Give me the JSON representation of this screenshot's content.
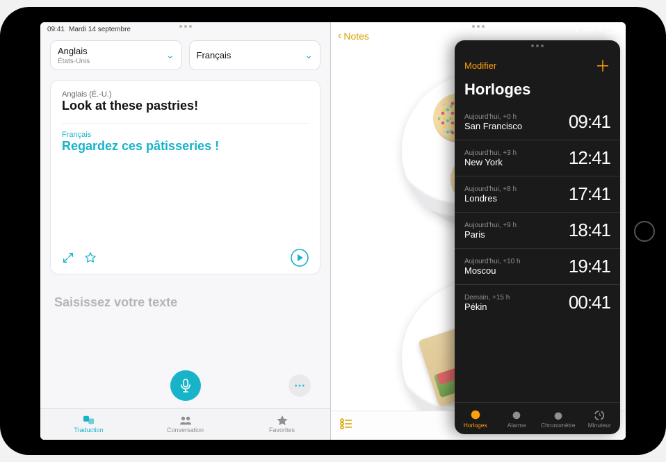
{
  "status": {
    "time": "09:41",
    "date": "Mardi 14 septembre",
    "battery_pct": "100 %"
  },
  "translate": {
    "lang_from": {
      "name": "Anglais",
      "region": "États-Unis"
    },
    "lang_to": {
      "name": "Français",
      "region": ""
    },
    "src_lang_label": "Anglais (É.-U.)",
    "src_text": "Look at these pastries!",
    "tgt_lang_label": "Français",
    "tgt_text": "Regardez ces pâtisseries !",
    "input_placeholder": "Saisissez votre texte",
    "tabs": [
      "Traduction",
      "Conversation",
      "Favorites"
    ]
  },
  "notes": {
    "back_label": "Notes"
  },
  "clock": {
    "edit_label": "Modifier",
    "title": "Horloges",
    "rows": [
      {
        "offset": "Aujourd'hui, +0 h",
        "city": "San Francisco",
        "time": "09:41"
      },
      {
        "offset": "Aujourd'hui, +3 h",
        "city": "New York",
        "time": "12:41"
      },
      {
        "offset": "Aujourd'hui, +8 h",
        "city": "Londres",
        "time": "17:41"
      },
      {
        "offset": "Aujourd'hui, +9 h",
        "city": "Paris",
        "time": "18:41"
      },
      {
        "offset": "Aujourd'hui, +10 h",
        "city": "Moscou",
        "time": "19:41"
      },
      {
        "offset": "Demain, +15 h",
        "city": "Pékin",
        "time": "00:41"
      }
    ],
    "tabs": [
      "Horloges",
      "Alarme",
      "Chronomètre",
      "Minuteur"
    ]
  }
}
